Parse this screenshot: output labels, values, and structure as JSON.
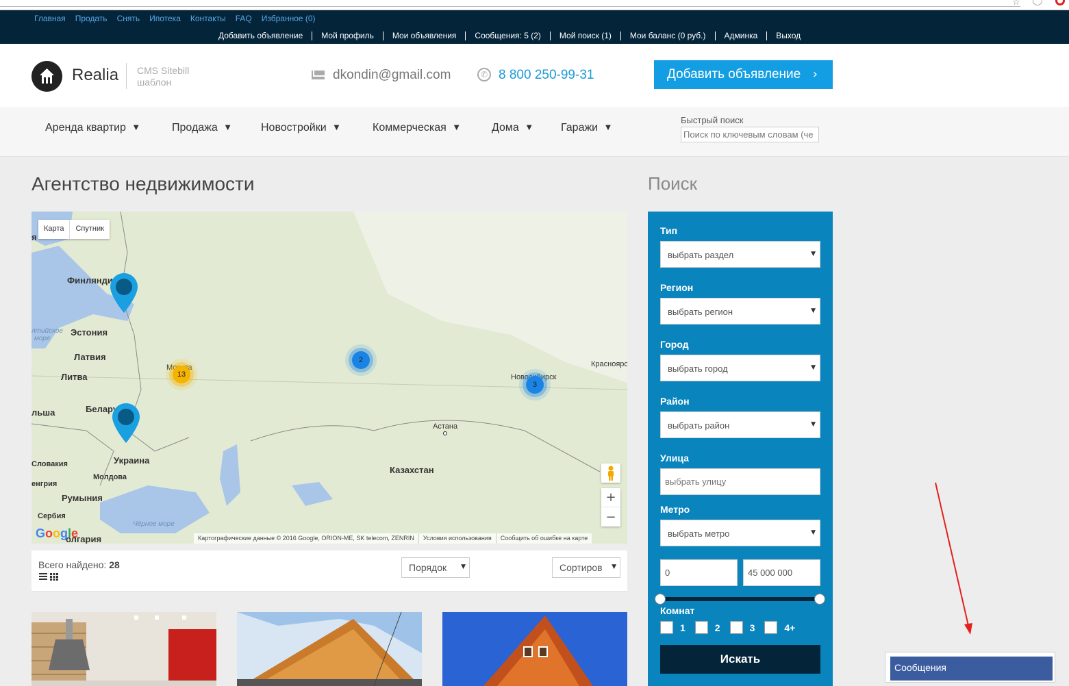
{
  "top_links": [
    "Главная",
    "Продать",
    "Снять",
    "Ипотека",
    "Контакты",
    "FAQ",
    "Избранное (0)"
  ],
  "user_links": [
    "Добавить объявление",
    "Мой профиль",
    "Мои объявления",
    "Сообщения: 5 (2)",
    "Мой поиск (1)",
    "Мои баланс (0 руб.)",
    "Админка",
    "Выход"
  ],
  "header": {
    "logo_name": "Realia",
    "logo_sub_1": "CMS Sitebill",
    "logo_sub_2": "шаблон",
    "email": "dkondin@gmail.com",
    "phone": "8 800 250-99-31",
    "add_button": "Добавить объявление",
    "icons": [
      "home-icon",
      "mail-icon",
      "phone-icon",
      "chevron-right-icon"
    ]
  },
  "nav": {
    "items": [
      "Аренда квартир",
      "Продажа",
      "Новостройки",
      "Коммерческая",
      "Дома",
      "Гаражи"
    ],
    "quick_search_label": "Быстрый поиск",
    "quick_search_placeholder": "Поиск по ключевым словам (че"
  },
  "main": {
    "title": "Агентство недвижимости",
    "map": {
      "type_buttons": [
        "Карта",
        "Спутник"
      ],
      "labels": {
        "finland": "Финлянди",
        "estonia": "Эстония",
        "latvia": "Латвия",
        "lithuania": "Литва",
        "belarus": "Белару",
        "ukraine": "Украина",
        "moldova": "Молдова",
        "romania": "Румыния",
        "slovakia": "Словакия",
        "hungary": "енгрия",
        "serbia": "Сербия",
        "bulgaria": "олгария",
        "poland": "льша",
        "kazakhstan": "Казахстан",
        "astana": "Астана",
        "moscow": "Москва",
        "novosibirsk": "Новосибирск",
        "krasnoyarsk": "Красноярс",
        "baltic": "лтийское",
        "baltic2": "море",
        "black_sea": "Чёрное море",
        "edge_ya": "я"
      },
      "clusters": [
        "13",
        "2",
        "3"
      ],
      "google": "Google",
      "attribution": [
        "Картографические данные © 2016 Google, ORION-ME, SK telecom, ZENRIN",
        "Условия использования",
        "Сообщить об ошибке на карте"
      ],
      "zoom_in": "+",
      "zoom_out": "−"
    },
    "found_label": "Всего найдено:",
    "found_count": "28",
    "order_select": "Порядок",
    "sort_select": "Сортиров"
  },
  "sidebar": {
    "title": "Поиск",
    "type_label": "Тип",
    "type_value": "выбрать раздел",
    "region_label": "Регион",
    "region_value": "выбрать регион",
    "city_label": "Город",
    "city_value": "выбрать город",
    "district_label": "Район",
    "district_value": "выбрать район",
    "street_label": "Улица",
    "street_placeholder": "выбрать улицу",
    "metro_label": "Метро",
    "metro_value": "выбрать метро",
    "price_min": "0",
    "price_max": "45 000 000",
    "rooms_label": "Комнат",
    "rooms": [
      "1",
      "2",
      "3",
      "4+"
    ],
    "search_button": "Искать"
  },
  "messages_widget": "Сообщения",
  "colors": {
    "admin_bar": "#04243a",
    "link": "#59a8e6",
    "accent": "#139ee3",
    "search_panel": "#0a84bd",
    "messages": "#3b5da0",
    "annotation_arrow": "#e3201c"
  }
}
